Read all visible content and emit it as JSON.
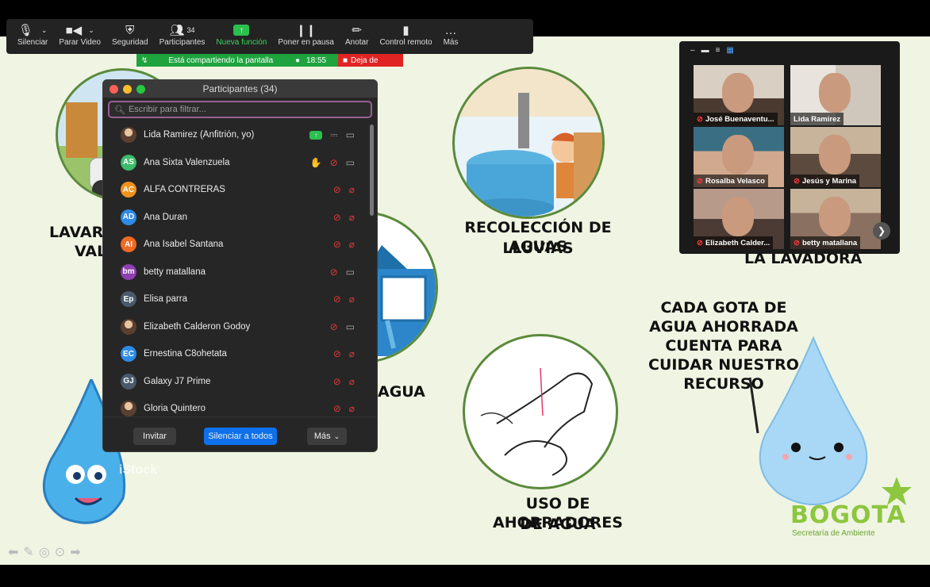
{
  "toolbar": {
    "buttons": [
      {
        "label": "Silenciar",
        "icon": "microphone-icon"
      },
      {
        "label": "Parar Video",
        "icon": "video-camera-icon"
      },
      {
        "label": "Seguridad",
        "icon": "shield-icon"
      },
      {
        "label": "Participantes",
        "icon": "participants-icon",
        "count": "34"
      },
      {
        "label": "Nueva función",
        "icon": "share-screen-icon"
      },
      {
        "label": "Poner en pausa",
        "icon": "pause-icon"
      },
      {
        "label": "Anotar",
        "icon": "pencil-icon"
      },
      {
        "label": "Control remoto",
        "icon": "mouse-icon"
      },
      {
        "label": "Más",
        "icon": "more-dots-icon"
      }
    ]
  },
  "share_bar": {
    "text": "Está compartiendo la pantalla",
    "time": "18:55",
    "stop_label": "Deja de"
  },
  "participants_panel": {
    "title": "Participantes (34)",
    "search_placeholder": "Escribir para filtrar...",
    "participants": [
      {
        "name": "Lida Ramirez (Anfitrión, yo)",
        "initials": "",
        "color": "#6b4a3a",
        "photo": true
      },
      {
        "name": "Ana Sixta Valenzuela",
        "initials": "AS",
        "color": "#3dbb6d"
      },
      {
        "name": "ALFA CONTRERAS",
        "initials": "AC",
        "color": "#f0931c"
      },
      {
        "name": "Ana Duran",
        "initials": "AD",
        "color": "#2e8be6"
      },
      {
        "name": "Ana Isabel Santana",
        "initials": "AI",
        "color": "#f06a24"
      },
      {
        "name": "betty matallana",
        "initials": "bm",
        "color": "#8e3fb0"
      },
      {
        "name": "Elisa parra",
        "initials": "Ep",
        "color": "#4a5a6b"
      },
      {
        "name": "Elizabeth Calderon Godoy",
        "initials": "",
        "color": "#777",
        "photo": true
      },
      {
        "name": "Ernestina C8ohetata",
        "initials": "EC",
        "color": "#2e8be6"
      },
      {
        "name": "Galaxy J7 Prime",
        "initials": "GJ",
        "color": "#4a5a6b"
      },
      {
        "name": "Gloria Quintero",
        "initials": "",
        "color": "#c9a23a",
        "photo": true
      }
    ],
    "footer": {
      "invite": "Invitar",
      "mute_all": "Silenciar a todos",
      "more": "Más"
    }
  },
  "gallery": {
    "tiles": [
      {
        "name": "José Buenaventu...",
        "muted": true
      },
      {
        "name": "Lida Ramirez",
        "muted": false
      },
      {
        "name": "Rosalba Velasco",
        "muted": true
      },
      {
        "name": "Jesús y Marina",
        "muted": true
      },
      {
        "name": "Elizabeth Calder...",
        "muted": true
      },
      {
        "name": "betty matallana",
        "muted": true
      }
    ]
  },
  "slide": {
    "captions": {
      "lavar_1": "LAVAR",
      "lavar_2": "VAL",
      "lluvias_1": "RECOLECCIÓN DE AGUAS",
      "lluvias_2": "LLUVIAS",
      "lavadora": "LA LAVADORA",
      "agua": "AGUA",
      "gota_1": "CADA GOTA DE",
      "gota_2": "AGUA AHORRADA",
      "gota_3": "CUENTA PARA",
      "gota_4": "CUIDAR NUESTRO",
      "gota_5": "RECURSO",
      "ahorradores_1": "USO DE AHORRADORES",
      "ahorradores_2": "DE AGUA"
    },
    "logo": {
      "main": "BOGOTA",
      "sub": "Secretaría de Ambiente"
    },
    "watermark": "iStock"
  }
}
